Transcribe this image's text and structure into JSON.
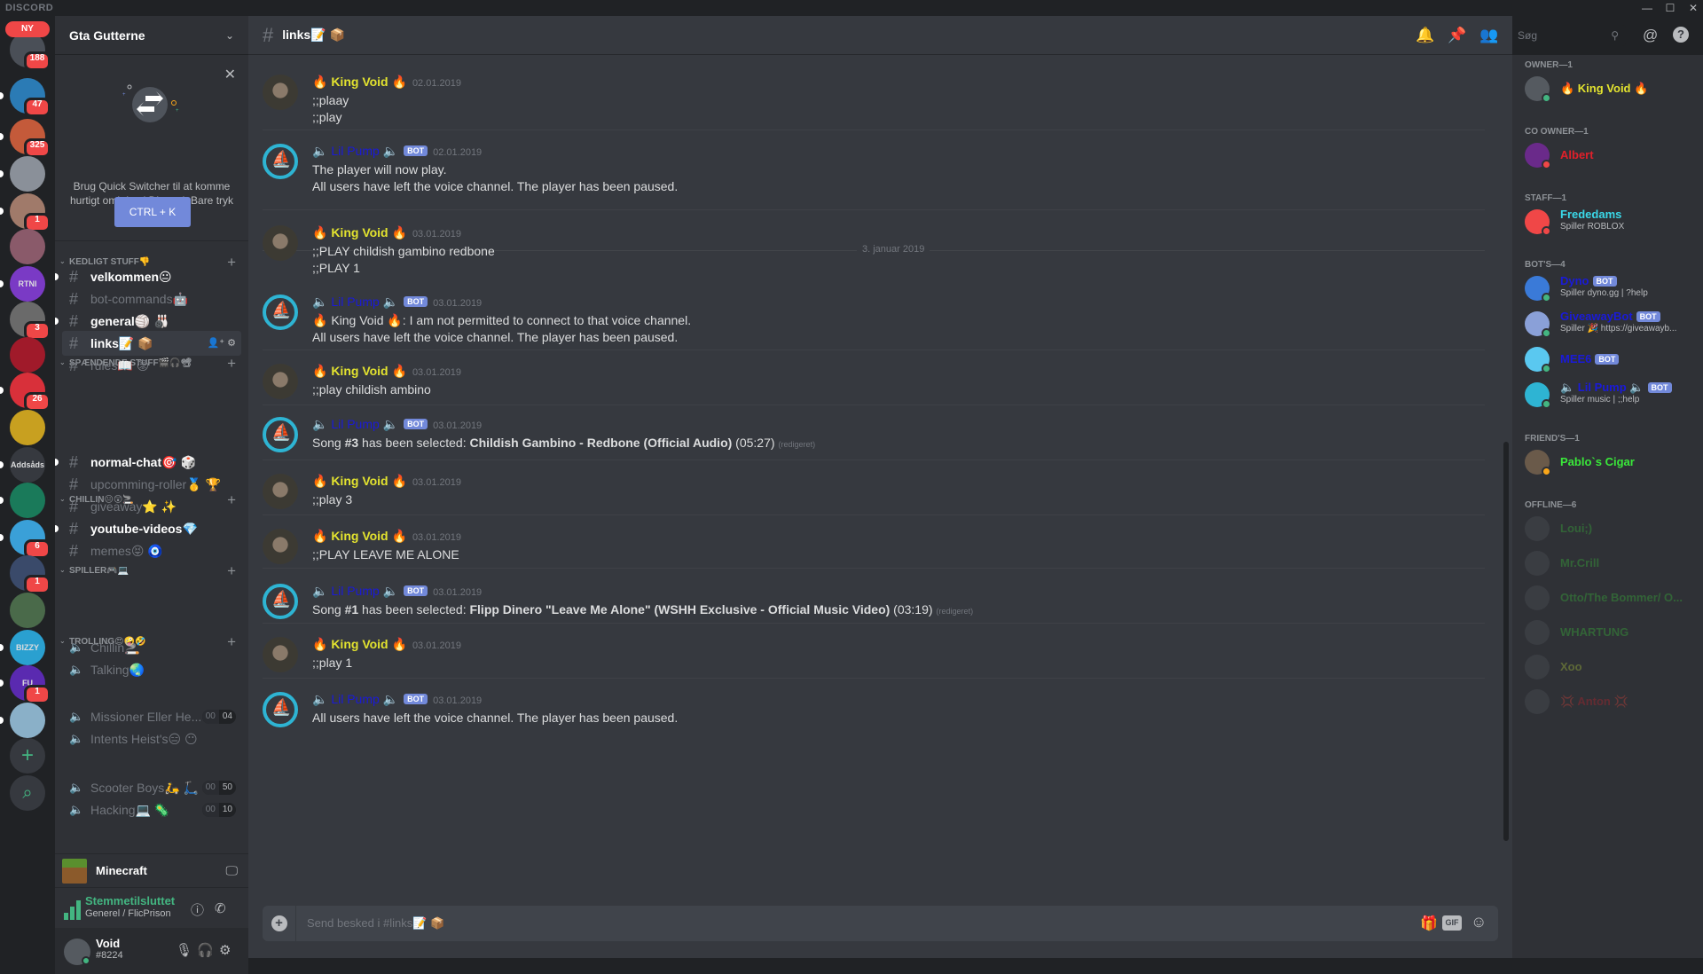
{
  "app": {
    "brand": "DISCORD",
    "window_controls": [
      "—",
      "☐",
      "✕"
    ]
  },
  "guilds": {
    "new_label": "NY",
    "items": [
      {
        "name": "home",
        "badge": "188",
        "color": "#4a4f57"
      },
      {
        "name": "eye-server",
        "badge": "47",
        "color": "#2b7bb5"
      },
      {
        "name": "rust-server",
        "badge": "325",
        "color": "#c45a3a"
      },
      {
        "name": "flag-server",
        "badge": "",
        "color": "#8a9099"
      },
      {
        "name": "face-server",
        "badge": "1",
        "color": "#a07a6a"
      },
      {
        "name": "gta-server",
        "badge": "",
        "color": "#8a5a6a"
      },
      {
        "name": "fortnite-server",
        "badge": "",
        "color": "#7a3ac5",
        "label": "RTNI"
      },
      {
        "name": "dog-server",
        "badge": "3",
        "color": "#6a6a6a"
      },
      {
        "name": "red-logo-server",
        "badge": "",
        "color": "#a01a2a"
      },
      {
        "name": "red-server",
        "badge": "26",
        "color": "#d8303a"
      },
      {
        "name": "emoji-server",
        "badge": "",
        "color": "#c8a020"
      },
      {
        "name": "addsads-server",
        "badge": "",
        "color": "#36393f",
        "label": "Addsåds"
      },
      {
        "name": "rainbow-server",
        "badge": "",
        "color": "#1a7a5a"
      },
      {
        "name": "sunglasses-server",
        "badge": "6",
        "color": "#3aa0d8"
      },
      {
        "name": "space-server",
        "badge": "1",
        "color": "#3a4a6a"
      },
      {
        "name": "thuglife-server",
        "badge": "",
        "color": "#4a6a4a"
      },
      {
        "name": "bizzy-server",
        "badge": "",
        "color": "#2aa0d0",
        "label": "BIZZY"
      },
      {
        "name": "fu-server",
        "badge": "1",
        "color": "#5a2ab0",
        "label": "FU"
      },
      {
        "name": "mountain-server",
        "badge": "",
        "color": "#8ab0c8"
      }
    ],
    "add_label": "+",
    "search_label": "⌕"
  },
  "server": {
    "name": "Gta Gutterne"
  },
  "quick_switcher": {
    "text": "Brug Quick Switcher til at komme hurtigt omkring i Discord. Bare tryk på:",
    "button": "CTRL + K"
  },
  "categories": [
    {
      "name": "KEDLIGT STUFF👎"
    },
    {
      "name": "SPÆNDENDE STUFF🎬🎧📽"
    },
    {
      "name": "CHILLIN😐😲🚬"
    },
    {
      "name": "SPILLER🎮💻"
    },
    {
      "name": "TROLLING😍🤪🤣"
    }
  ],
  "channels": [
    {
      "name": "velkommen😐",
      "type": "text",
      "state": "unread"
    },
    {
      "name": "bot-commands🤖",
      "type": "text",
      "state": "read"
    },
    {
      "name": "general🏐 🎳",
      "type": "text",
      "state": "unread"
    },
    {
      "name": "links📝 📦",
      "type": "text",
      "state": "selected"
    },
    {
      "name": "rules📖 😡",
      "type": "text",
      "state": "read"
    },
    {
      "name": "normal-chat🎯 🎲",
      "type": "text",
      "state": "unread"
    },
    {
      "name": "upcomming-roller🥇 🏆",
      "type": "text",
      "state": "read"
    },
    {
      "name": "giveaway⭐ ✨",
      "type": "text",
      "state": "read"
    },
    {
      "name": "youtube-videos💎",
      "type": "text",
      "state": "unread"
    },
    {
      "name": "memes😝 🧿",
      "type": "text",
      "state": "read"
    },
    {
      "name": "Chillin🚬",
      "type": "voice",
      "state": "read"
    },
    {
      "name": "Talking🌏",
      "type": "voice",
      "state": "read"
    },
    {
      "name": "Missioner Eller He...",
      "type": "voice",
      "state": "read",
      "count": [
        "00",
        "04"
      ]
    },
    {
      "name": "Intents Heist's😑 😶",
      "type": "voice",
      "state": "read"
    },
    {
      "name": "Scooter Boys🛵 🛴",
      "type": "voice",
      "state": "read",
      "count": [
        "00",
        "50"
      ]
    },
    {
      "name": "Hacking💻 🦠",
      "type": "voice",
      "state": "read",
      "count": [
        "00",
        "10"
      ]
    }
  ],
  "activity": {
    "game": "Minecraft"
  },
  "voice_status": {
    "status": "Stemmetilsluttet",
    "channel": "Generel / FlicPrison"
  },
  "user": {
    "name": "Void",
    "tag": "#8224"
  },
  "header": {
    "channel": "links📝 📦",
    "search_placeholder": "Søg"
  },
  "date_divider": "3. januar 2019",
  "messages": [
    {
      "author": "🔥 King Void 🔥",
      "kind": "kv",
      "bot": false,
      "ts": "02.01.2019",
      "lines": [
        ";;plaay",
        ";;play"
      ]
    },
    {
      "author": "🔈 Lil Pump 🔈",
      "kind": "lp",
      "bot": true,
      "ts": "02.01.2019",
      "lines": [
        "The player will now play.",
        "All users have left the voice channel. The player has been paused."
      ]
    },
    {
      "author": "🔥 King Void 🔥",
      "kind": "kv",
      "bot": false,
      "ts": "03.01.2019",
      "lines": [
        ";;PLAY childish gambino redbone",
        ";;PLAY 1"
      ]
    },
    {
      "author": "🔈 Lil Pump 🔈",
      "kind": "lp",
      "bot": true,
      "ts": "03.01.2019",
      "lines": [
        "🔥 King Void 🔥:  I am not permitted to connect to that voice channel.",
        "All users have left the voice channel. The player has been paused."
      ]
    },
    {
      "author": "🔥 King Void 🔥",
      "kind": "kv",
      "bot": false,
      "ts": "03.01.2019",
      "lines": [
        ";;play childish ambino"
      ]
    },
    {
      "author": "🔈 Lil Pump 🔈",
      "kind": "lp",
      "bot": true,
      "ts": "03.01.2019",
      "song": {
        "prefix": "Song ",
        "num": "#3",
        "mid": " has been selected: ",
        "title": "Childish Gambino - Redbone (Official Audio)",
        "dur": " (05:27)",
        "edited": "(redigeret)"
      }
    },
    {
      "author": "🔥 King Void 🔥",
      "kind": "kv",
      "bot": false,
      "ts": "03.01.2019",
      "lines": [
        ";;play 3"
      ]
    },
    {
      "author": "🔥 King Void 🔥",
      "kind": "kv",
      "bot": false,
      "ts": "03.01.2019",
      "lines": [
        ";;PLAY LEAVE ME ALONE"
      ]
    },
    {
      "author": "🔈 Lil Pump 🔈",
      "kind": "lp",
      "bot": true,
      "ts": "03.01.2019",
      "song": {
        "prefix": "Song ",
        "num": "#1",
        "mid": " has been selected: ",
        "title": "Flipp Dinero \"Leave Me Alone\" (WSHH Exclusive - Official Music Video)",
        "dur": " (03:19)",
        "edited": "(redigeret)"
      }
    },
    {
      "author": "🔥 King Void 🔥",
      "kind": "kv",
      "bot": false,
      "ts": "03.01.2019",
      "lines": [
        ";;play 1"
      ]
    },
    {
      "author": "🔈 Lil Pump 🔈",
      "kind": "lp",
      "bot": true,
      "ts": "03.01.2019",
      "lines": [
        "All users have left the voice channel. The player has been paused."
      ]
    }
  ],
  "bot_tag": "BOT",
  "composer": {
    "placeholder": "Send besked i #links📝 📦",
    "gif": "GIF"
  },
  "members": {
    "groups": [
      {
        "title": "OWNER—1",
        "members": [
          {
            "name": "🔥 King Void 🔥",
            "color": "#e3e32f",
            "status": "#43b581"
          }
        ]
      },
      {
        "title": "CO OWNER—1",
        "members": [
          {
            "name": "Albert",
            "color": "#e0202a",
            "status": "#f04747",
            "avatar": "#6a2a8a"
          }
        ]
      },
      {
        "title": "STAFF—1",
        "members": [
          {
            "name": "Frededams",
            "color": "#3ad8e8",
            "status": "#f04747",
            "sub": "Spiller ROBLOX",
            "avatar": "#f04747"
          }
        ]
      },
      {
        "title": "BOT'S—4",
        "members": [
          {
            "name": "Dyno",
            "color": "#1a1ad8",
            "status": "#43b581",
            "bot": true,
            "sub": "Spiller dyno.gg | ?help",
            "avatar": "#3a7ad8"
          },
          {
            "name": "GiveawayBot",
            "color": "#1a1ad8",
            "status": "#43b581",
            "bot": true,
            "sub": "Spiller 🎉 https://giveawayb...",
            "avatar": "#8aa0d8"
          },
          {
            "name": "MEE6",
            "color": "#1a1ad8",
            "status": "#43b581",
            "bot": true,
            "avatar": "#5ac8f0"
          },
          {
            "name": "🔈 Lil Pump 🔈",
            "color": "#1a1ad8",
            "status": "#43b581",
            "bot": true,
            "sub": "Spiller music | ;;help",
            "avatar": "#2eb4d3"
          }
        ]
      },
      {
        "title": "FRIEND'S—1",
        "members": [
          {
            "name": "Pablo`s Cigar",
            "color": "#3ae83a",
            "status": "#faa61a",
            "avatar": "#6a5a4a"
          }
        ]
      },
      {
        "title": "OFFLINE—6",
        "offline": true,
        "members": [
          {
            "name": "Loui;)",
            "color": "#3ad83a"
          },
          {
            "name": "Mr.Crill",
            "color": "#3ad83a"
          },
          {
            "name": "Otto/The Bommer/ O...",
            "color": "#3ad83a"
          },
          {
            "name": "WHARTUNG",
            "color": "#3ad83a"
          },
          {
            "name": "Xoo",
            "color": "#c8e83a"
          },
          {
            "name": "💢 Anton 💢",
            "color": "#e0202a"
          }
        ]
      }
    ]
  }
}
